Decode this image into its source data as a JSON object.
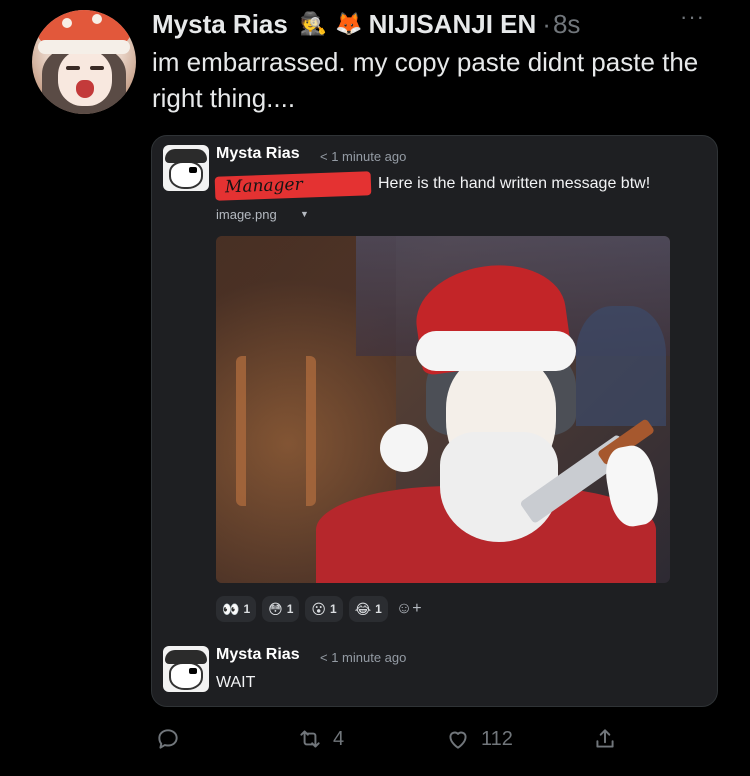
{
  "tweet": {
    "author_name": "Mysta Rias",
    "emoji_1": "🕵",
    "emoji_2": "🦊",
    "org": "NIJISANJI EN",
    "separator": "·",
    "time": "8s",
    "more": "···",
    "text": "im embarrassed. my copy paste didnt paste the right thing...."
  },
  "embedded": {
    "message_1": {
      "name": "Mysta Rias",
      "time": "< 1 minute ago",
      "redacted_tag": "Manager",
      "text": "Here is the hand written message btw!",
      "attachment_name": "image.png",
      "attachment_caret": "▼"
    },
    "reactions": [
      {
        "icon": "👀",
        "count": "1"
      },
      {
        "icon": "😳",
        "count": "1"
      },
      {
        "icon": "😮",
        "count": "1"
      },
      {
        "icon": "😂",
        "count": "1"
      }
    ],
    "add_reaction_icon": "☺+",
    "message_2": {
      "name": "Mysta Rias",
      "time": "< 1 minute ago",
      "text": "WAIT"
    }
  },
  "actions": {
    "reply_count": "",
    "retweet_count": "4",
    "like_count": "112"
  },
  "colors": {
    "background": "#000000",
    "card": "#1e1f22",
    "muted": "#71767b",
    "redact": "#e43232"
  }
}
